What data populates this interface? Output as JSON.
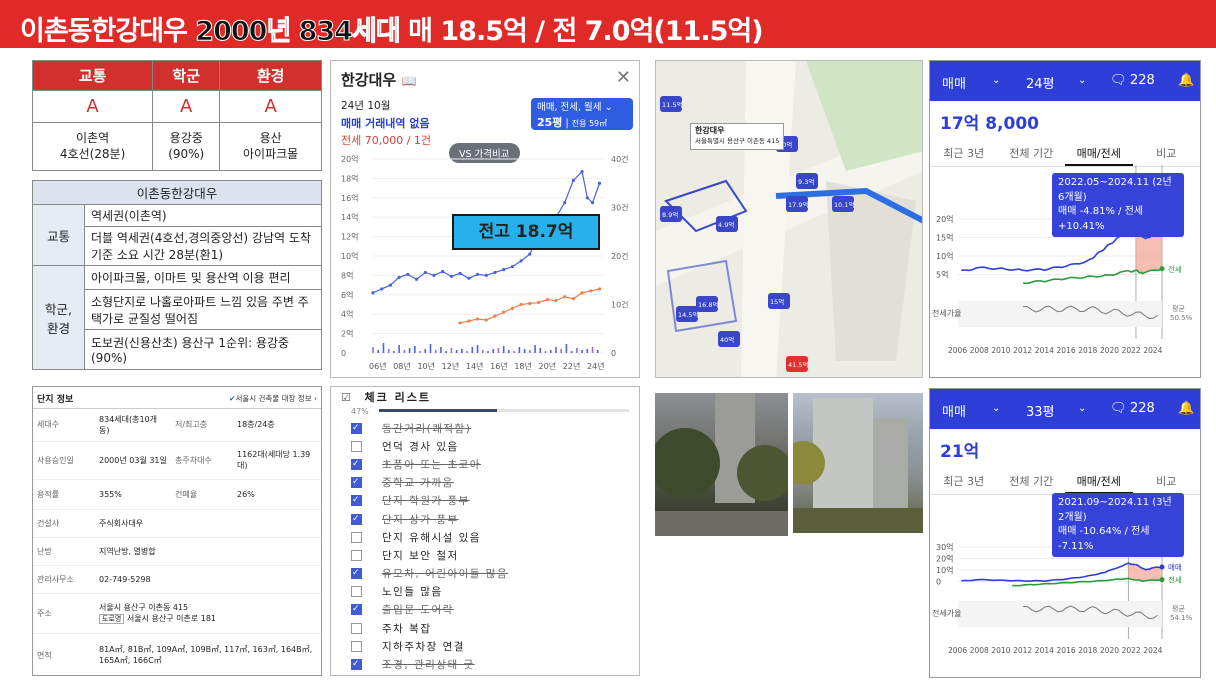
{
  "title": {
    "part1": "이촌동한강대우",
    "part2": "2000년 834세대",
    "part3": "매 18.5억 / 전 7.0억(11.5억)"
  },
  "ratings": {
    "headers": [
      "교통",
      "학군",
      "환경"
    ],
    "grades": [
      "A",
      "A",
      "A"
    ],
    "info": [
      [
        "이촌역",
        "4호선(28분)"
      ],
      [
        "용강중",
        "(90%)"
      ],
      [
        "용산",
        "아이파크몰"
      ]
    ]
  },
  "summary": {
    "heading": "이촌동한강대우",
    "groups": [
      {
        "label": "교통",
        "rows": [
          "역세권(이촌역)",
          "더블 역세권(4호선,경의중앙선) 강남역 도착 기준 소요 시간 28분(환1)"
        ]
      },
      {
        "label": "학군, 환경",
        "rows": [
          "아이파크몰, 이마트 및 용산역 이용 편리",
          "소형단지로 나홀로아파트 느낌 있음 주변 주택가로 균질성 떨어짐",
          "도보권(신용산초) 용산구 1순위: 용강중(90%)"
        ]
      }
    ]
  },
  "listing": {
    "name": "한강대우",
    "month": "24년 10월",
    "no_deal": "매매 거래내역 없음",
    "jeonse": "전세 70,000 / 1건",
    "deal_type": "매매, 전세, 월세",
    "size": "25평",
    "size_detail": "전용 59㎡",
    "vs_button": "VS 가격비교",
    "highlight": "전고 18.7억",
    "y_left": [
      "20억",
      "18억",
      "16억",
      "14억",
      "12억",
      "10억",
      "8억",
      "6억",
      "4억",
      "2억",
      "0"
    ],
    "y_right": [
      "40건",
      "30건",
      "20건",
      "10건",
      "0"
    ],
    "x_labels": [
      "06년",
      "08년",
      "10년",
      "12년",
      "14년",
      "16년",
      "18년",
      "20년",
      "22년",
      "24년"
    ]
  },
  "map": {
    "complex_name": "한강대우",
    "address": "서울특별시 용산구 이촌동 415",
    "labels": [
      "11.5억",
      "8.9억",
      "4.9억",
      "10억",
      "17.9억",
      "14.5억",
      "16.8억",
      "15억",
      "40억",
      "41.5억",
      "9.3억",
      "10.1억"
    ]
  },
  "price_card_1": {
    "type": "매매",
    "size": "24평",
    "count": "228",
    "price": "17억 8,000",
    "tabs": [
      "최근 3년",
      "전체 기간",
      "매매/전세",
      "비교"
    ],
    "bubble_line1": "2022.05~2024.11 (2년 6개월)",
    "bubble_line2": "매매 -4.81% / 전세 +10.41%",
    "y_labels": [
      "20억",
      "15억",
      "10억",
      "5억"
    ],
    "sale_label": "매매",
    "jeonse_label": "전세",
    "ratio_label": "전세가율",
    "avg_label": "평균",
    "avg_value": "50.5%",
    "x_labels": [
      "2006",
      "2008",
      "2010",
      "2012",
      "2014",
      "2016",
      "2018",
      "2020",
      "2022",
      "2024"
    ]
  },
  "price_card_2": {
    "type": "매매",
    "size": "33평",
    "count": "228",
    "price": "21억",
    "tabs": [
      "최근 3년",
      "전체 기간",
      "매매/전세",
      "비교"
    ],
    "bubble_line1": "2021.09~2024.11 (3년 2개월)",
    "bubble_line2": "매매 -10.64% / 전세 -7.11%",
    "y_labels": [
      "30억",
      "20억",
      "10억",
      "0"
    ],
    "sale_label": "매매",
    "jeonse_label": "전세",
    "ratio_label": "전세가율",
    "avg_label": "평균",
    "avg_value": "54.1%",
    "x_labels": [
      "2006",
      "2008",
      "2010",
      "2012",
      "2014",
      "2016",
      "2018",
      "2020",
      "2022",
      "2024"
    ]
  },
  "complex_info": {
    "title": "단지 정보",
    "link": "서울시 건축물 대장 정보",
    "rows": [
      {
        "k1": "세대수",
        "v1": "834세대(총10개동)",
        "k2": "저/최고층",
        "v2": "18층/24층"
      },
      {
        "k1": "사용승인일",
        "v1": "2000년 03월 31일",
        "k2": "총주차대수",
        "v2": "1162대(세대당 1.39대)"
      },
      {
        "k1": "용적률",
        "v1": "355%",
        "k2": "건폐율",
        "v2": "26%"
      },
      {
        "k1": "건설사",
        "v1": "주식회사대우"
      },
      {
        "k1": "난방",
        "v1": "지역난방, 열병합"
      },
      {
        "k1": "관리사무소",
        "v1": "02-749-5298"
      },
      {
        "k1": "주소",
        "v1": "서울시 용산구 이촌동 415",
        "v1b": "서울시 용산구 이촌로 181",
        "tag": "도로명"
      },
      {
        "k1": "면적",
        "v1": "81A㎡, 81B㎡, 109A㎡, 109B㎡, 117㎡, 163㎡, 164B㎡, 165A㎡, 166C㎡"
      }
    ]
  },
  "checklist": {
    "title": "체크 리스트",
    "percent": "47%",
    "progress": 0.47,
    "items": [
      {
        "text": "동간거리(쾌적함)",
        "checked": true
      },
      {
        "text": "언덕 경사 있음",
        "checked": false
      },
      {
        "text": "초품아 또는 초코아",
        "checked": true
      },
      {
        "text": "중학교 가까움",
        "checked": true
      },
      {
        "text": "단지 학원가 풍부",
        "checked": true
      },
      {
        "text": "단지 상가 풍부",
        "checked": true
      },
      {
        "text": "단지 유해시설 있음",
        "checked": false
      },
      {
        "text": "단지 보안 철저",
        "checked": false
      },
      {
        "text": "유모차, 어린아이들 많음",
        "checked": true
      },
      {
        "text": "노인들 많음",
        "checked": false
      },
      {
        "text": "출입문 도어락",
        "checked": true
      },
      {
        "text": "주차 복잡",
        "checked": false
      },
      {
        "text": "지하주차장 연결",
        "checked": false
      },
      {
        "text": "조경, 관리상태 굿",
        "checked": true
      }
    ]
  },
  "colors": {
    "accent_red": "#e02a28",
    "sale_blue": "#2e3fd8",
    "jeonse_green": "#2a9a3a"
  }
}
